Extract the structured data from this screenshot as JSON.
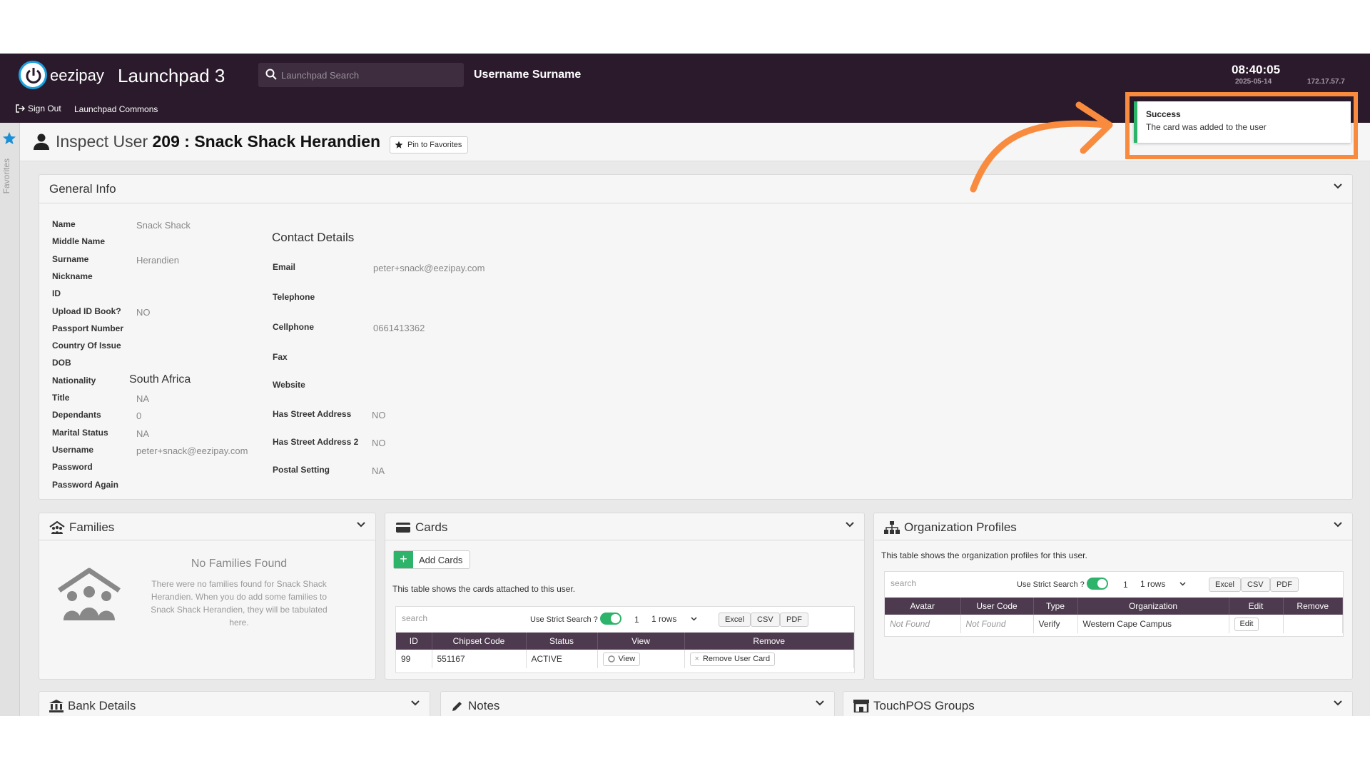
{
  "header": {
    "brand": "eezipay",
    "app_title": "Launchpad 3",
    "search_placeholder": "Launchpad Search",
    "username": "Username Surname",
    "time": "08:40:05",
    "date": "2025-05-14",
    "ip": "172.17.57.7",
    "sign_out": "Sign Out",
    "commons": "Launchpad Commons"
  },
  "rail": {
    "favorites_label": "Favorites"
  },
  "page": {
    "title_prefix": "Inspect User",
    "user_id": "209",
    "separator": ":",
    "user_name": "Snack Shack Herandien",
    "pin_label": "Pin to Favorites"
  },
  "toast": {
    "title": "Success",
    "message": "The card was added to the user"
  },
  "general_info": {
    "title": "General Info",
    "fields": [
      {
        "label": "Name",
        "value": "Snack Shack"
      },
      {
        "label": "Middle Name",
        "value": ""
      },
      {
        "label": "Surname",
        "value": "Herandien"
      },
      {
        "label": "Nickname",
        "value": ""
      },
      {
        "label": "ID",
        "value": ""
      },
      {
        "label": "Upload ID Book?",
        "value": "NO"
      },
      {
        "label": "Passport Number",
        "value": ""
      },
      {
        "label": "Country Of Issue",
        "value": ""
      },
      {
        "label": "DOB",
        "value": ""
      },
      {
        "label": "Nationality",
        "value": "South Africa"
      },
      {
        "label": "Title",
        "value": "NA"
      },
      {
        "label": "Dependants",
        "value": "0"
      },
      {
        "label": "Marital Status",
        "value": "NA"
      },
      {
        "label": "Username",
        "value": "peter+snack@eezipay.com"
      },
      {
        "label": "Password",
        "value": ""
      },
      {
        "label": "Password Again",
        "value": ""
      }
    ],
    "contact_title": "Contact Details",
    "contact": [
      {
        "label": "Email",
        "value": "peter+snack@eezipay.com"
      },
      {
        "label": "Telephone",
        "value": ""
      },
      {
        "label": "Cellphone",
        "value": "0661413362"
      },
      {
        "label": "Fax",
        "value": ""
      },
      {
        "label": "Website",
        "value": ""
      },
      {
        "label": "Has Street Address",
        "value": "NO"
      },
      {
        "label": "Has Street Address 2",
        "value": "NO"
      },
      {
        "label": "Postal Setting",
        "value": "NA"
      }
    ]
  },
  "families": {
    "title": "Families",
    "empty_title": "No Families Found",
    "empty_text": "There were no families found for Snack Shack Herandien. When you do add some families to Snack Shack Herandien, they will be tabulated here."
  },
  "cards": {
    "title": "Cards",
    "add_label": "Add Cards",
    "description": "This table shows the cards attached to this user.",
    "search_placeholder": "search",
    "strict_label": "Use Strict Search ?",
    "page": "1",
    "rows_label": "1 rows",
    "exports": [
      "Excel",
      "CSV",
      "PDF"
    ],
    "columns": [
      "ID",
      "Chipset Code",
      "Status",
      "View",
      "Remove"
    ],
    "rows": [
      {
        "id": "99",
        "chipset": "551167",
        "status": "ACTIVE",
        "view": "View",
        "remove": "Remove User Card"
      }
    ]
  },
  "org_profiles": {
    "title": "Organization Profiles",
    "description": "This table shows the organization profiles for this user.",
    "search_placeholder": "search",
    "strict_label": "Use Strict Search ?",
    "page": "1",
    "rows_label": "1 rows",
    "exports": [
      "Excel",
      "CSV",
      "PDF"
    ],
    "columns": [
      "Avatar",
      "User Code",
      "Type",
      "Organization",
      "Edit",
      "Remove"
    ],
    "rows": [
      {
        "avatar": "Not Found",
        "user_code": "Not Found",
        "type": "Verify",
        "organization": "Western Cape Campus",
        "edit": "Edit",
        "remove": ""
      }
    ]
  },
  "bottom_panels": [
    {
      "title": "Bank Details"
    },
    {
      "title": "Notes"
    },
    {
      "title": "TouchPOS Groups"
    }
  ],
  "colors": {
    "header_bg": "#2b1a2c",
    "accent_green": "#2db36a",
    "highlight_orange": "#f98b3e",
    "table_header": "#4d3a4f"
  }
}
